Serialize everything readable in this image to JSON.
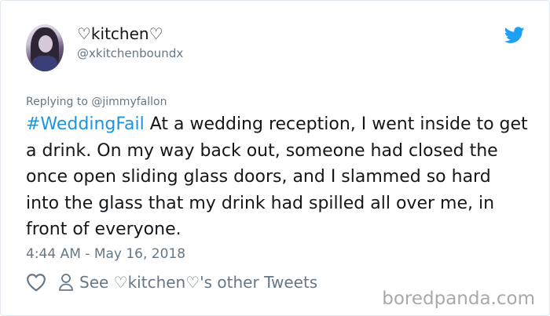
{
  "user": {
    "display_name": "♡kitchen♡",
    "handle": "@xkitchenboundx"
  },
  "reply": {
    "prefix": "Replying to ",
    "mention": "@jimmyfallon"
  },
  "tweet": {
    "hashtag": "#WeddingFail",
    "text": " At a wedding reception, I went inside to get a drink. On my way back out, someone had closed the once open sliding glass doors, and I slammed so hard into the glass that my drink had spilled all over me, in front of everyone."
  },
  "timestamp": "4:44 AM - May 16, 2018",
  "actions": {
    "see_tweets_label": "See ♡kitchen♡'s other Tweets"
  },
  "watermark": "boredpanda.com",
  "icons": {
    "platform": "twitter-bird-icon",
    "like": "heart-icon",
    "profile": "person-icon"
  },
  "colors": {
    "hashtag": "#1b95e0",
    "secondary_text": "#657786",
    "bird": "#1da1f2"
  }
}
